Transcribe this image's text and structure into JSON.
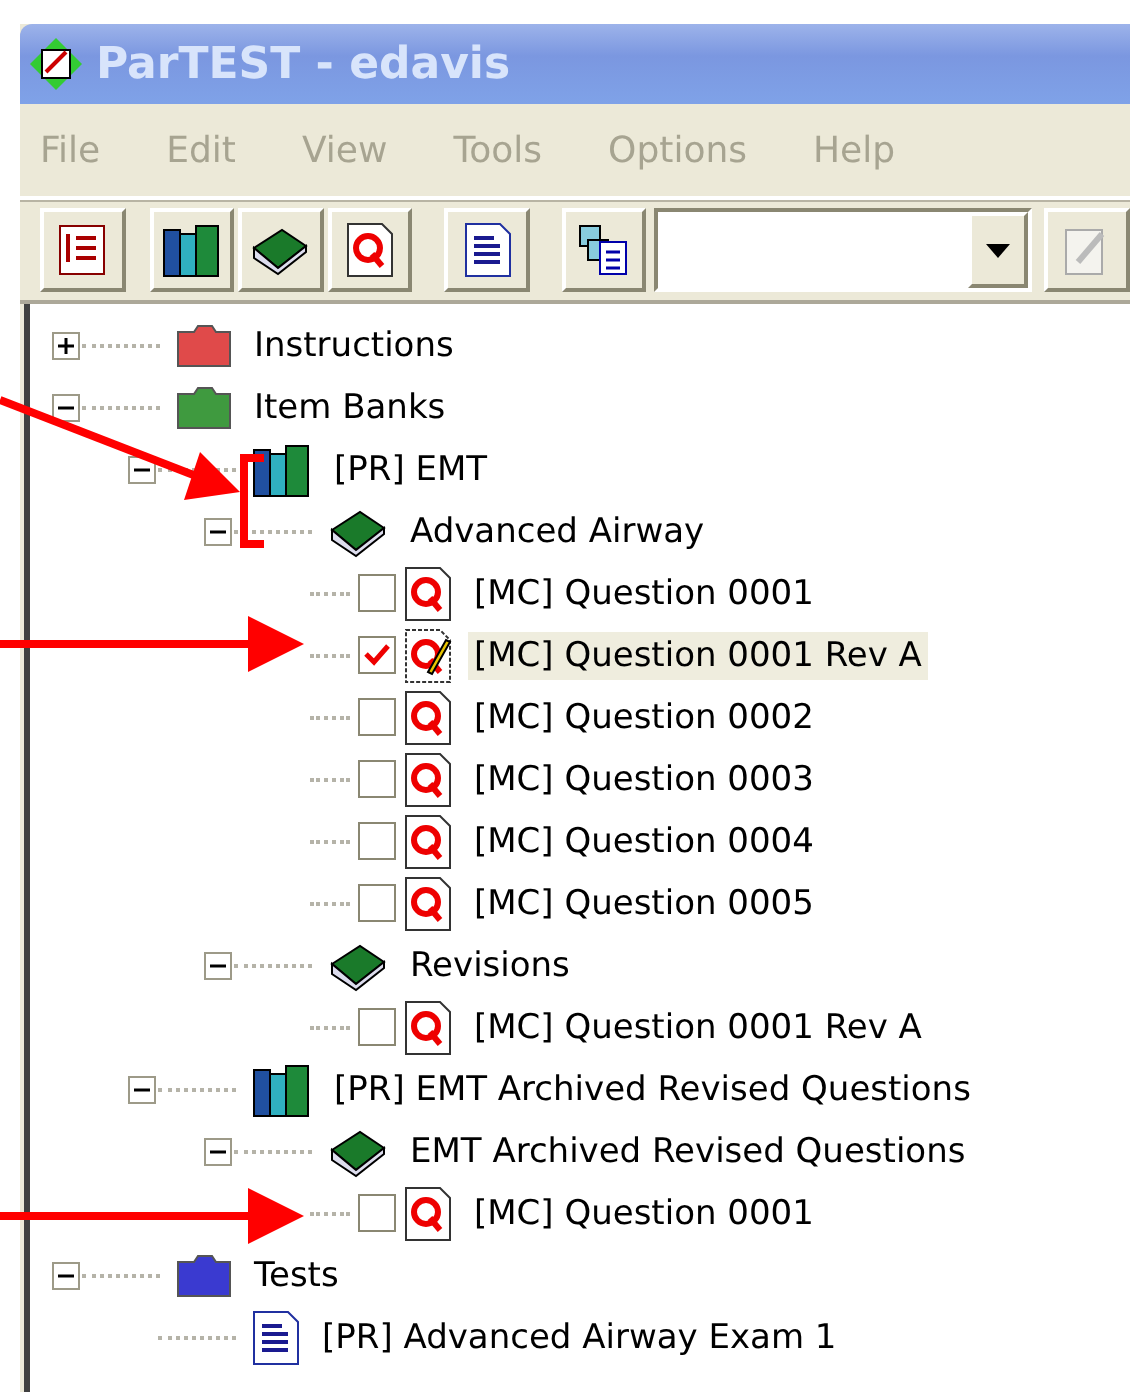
{
  "window": {
    "title": "ParTEST - edavis"
  },
  "menu": [
    {
      "label": "File",
      "disabled": true
    },
    {
      "label": "Edit",
      "disabled": true
    },
    {
      "label": "View",
      "disabled": true
    },
    {
      "label": "Tools",
      "disabled": true
    },
    {
      "label": "Options",
      "disabled": true
    },
    {
      "label": "Help",
      "disabled": true
    }
  ],
  "tree": [
    {
      "label": "Instructions",
      "kind": "folder",
      "color": "#e04a4a",
      "expanded": false,
      "selected": false
    },
    {
      "label": "Item Banks",
      "kind": "folder",
      "color": "#3f9a3f",
      "expanded": true,
      "selected": false,
      "children": [
        {
          "label": "[PR] EMT",
          "kind": "project",
          "expanded": true,
          "selected": false,
          "children": [
            {
              "label": "Advanced Airway",
              "kind": "bank",
              "expanded": true,
              "selected": false,
              "children": [
                {
                  "label": "[MC] Question 0001",
                  "kind": "question",
                  "checked": false,
                  "selected": false
                },
                {
                  "label": "[MC] Question 0001 Rev A",
                  "kind": "draft",
                  "checked": true,
                  "selected": true
                },
                {
                  "label": "[MC] Question 0002",
                  "kind": "question",
                  "checked": false,
                  "selected": false
                },
                {
                  "label": "[MC] Question 0003",
                  "kind": "question",
                  "checked": false,
                  "selected": false
                },
                {
                  "label": "[MC] Question 0004",
                  "kind": "question",
                  "checked": false,
                  "selected": false
                },
                {
                  "label": "[MC] Question 0005",
                  "kind": "question",
                  "checked": false,
                  "selected": false
                }
              ]
            },
            {
              "label": "Revisions",
              "kind": "bank",
              "expanded": true,
              "selected": false,
              "children": [
                {
                  "label": "[MC] Question 0001 Rev A",
                  "kind": "question",
                  "checked": false,
                  "selected": false
                }
              ]
            }
          ]
        },
        {
          "label": "[PR] EMT Archived Revised Questions",
          "kind": "project",
          "expanded": true,
          "selected": false,
          "children": [
            {
              "label": "EMT Archived Revised Questions",
              "kind": "bank",
              "expanded": true,
              "selected": false,
              "children": [
                {
                  "label": "[MC] Question 0001",
                  "kind": "question",
                  "checked": false,
                  "selected": false
                }
              ]
            }
          ]
        }
      ]
    },
    {
      "label": "Tests",
      "kind": "folder",
      "color": "#3a3ad0",
      "expanded": true,
      "selected": false,
      "children": [
        {
          "label": "[PR] Advanced Airway Exam 1",
          "kind": "test",
          "selected": false
        }
      ]
    }
  ]
}
